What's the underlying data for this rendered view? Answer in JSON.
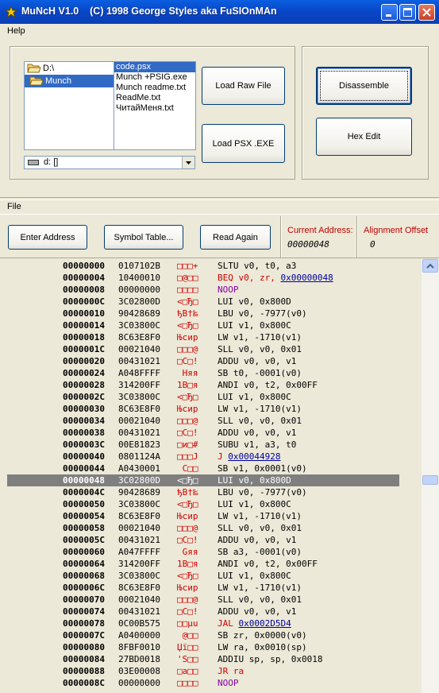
{
  "window": {
    "title": "MuNcH V1.0    (C) 1998 George Styles aka FuSIOnMAn"
  },
  "top_menu": {
    "help": "Help"
  },
  "dirs": [
    {
      "label": "D:\\",
      "selected": false
    },
    {
      "label": "Munch",
      "selected": true
    }
  ],
  "files": [
    {
      "label": "code.psx",
      "selected": true
    },
    {
      "label": "Munch +PSIG.exe",
      "selected": false
    },
    {
      "label": "Munch readme.txt",
      "selected": false
    },
    {
      "label": "ReadMe.txt",
      "selected": false
    },
    {
      "label": "ЧитайМеня.txt",
      "selected": false
    }
  ],
  "drive": {
    "value": "d: []"
  },
  "buttons": {
    "load_raw": "Load Raw File",
    "load_psx": "Load PSX .EXE",
    "disassemble": "Disassemble",
    "hex_edit": "Hex Edit",
    "enter_address": "Enter Address",
    "symbol_table": "Symbol Table...",
    "read_again": "Read Again"
  },
  "lower_menu": {
    "file": "File"
  },
  "info": {
    "current_address_label": "Current Address:",
    "current_address_value": "00000048",
    "alignment_label": "Alignment Offset",
    "alignment_value": "0"
  },
  "colors": {
    "titlebar": "#0847c8",
    "selection": "#316ac5",
    "branch": "#d00000",
    "nop": "#8800aa",
    "link": "#0000a0"
  },
  "rows": [
    {
      "addr": "00000000",
      "op": "0107102B",
      "chr": "□□□+",
      "mn": "SLTU v0, t0, a3",
      "kind": "normal"
    },
    {
      "addr": "00000004",
      "op": "10400010",
      "chr": "□@□□",
      "mn": "BEQ v0, zr, ",
      "link": "0x00000048",
      "kind": "branch"
    },
    {
      "addr": "00000008",
      "op": "00000000",
      "chr": "□□□□",
      "mn": "NOOP",
      "kind": "nop"
    },
    {
      "addr": "0000000C",
      "op": "3C02800D",
      "chr": "<□Ђ□",
      "mn": "LUI v0, 0x800D",
      "kind": "normal"
    },
    {
      "addr": "00000010",
      "op": "90428689",
      "chr": "ђB†‰",
      "mn": "LBU v0, -7977(v0)",
      "kind": "normal"
    },
    {
      "addr": "00000014",
      "op": "3C03800C",
      "chr": "<□Ђ□",
      "mn": "LUI v1, 0x800C",
      "kind": "normal"
    },
    {
      "addr": "00000018",
      "op": "8C63E8F0",
      "chr": "Њcир",
      "mn": "LW v1, -1710(v1)",
      "kind": "normal"
    },
    {
      "addr": "0000001C",
      "op": "00021040",
      "chr": "□□□@",
      "mn": "SLL v0, v0, 0x01",
      "kind": "normal"
    },
    {
      "addr": "00000020",
      "op": "00431021",
      "chr": "□C□!",
      "mn": "ADDU v0, v0, v1",
      "kind": "normal"
    },
    {
      "addr": "00000024",
      "op": "A048FFFF",
      "chr": " Hяя",
      "mn": "SB t0, -0001(v0)",
      "kind": "normal"
    },
    {
      "addr": "00000028",
      "op": "314200FF",
      "chr": "1B□я",
      "mn": "ANDI v0, t2, 0x00FF",
      "kind": "normal"
    },
    {
      "addr": "0000002C",
      "op": "3C03800C",
      "chr": "<□Ђ□",
      "mn": "LUI v1, 0x800C",
      "kind": "normal"
    },
    {
      "addr": "00000030",
      "op": "8C63E8F0",
      "chr": "Њcир",
      "mn": "LW v1, -1710(v1)",
      "kind": "normal"
    },
    {
      "addr": "00000034",
      "op": "00021040",
      "chr": "□□□@",
      "mn": "SLL v0, v0, 0x01",
      "kind": "normal"
    },
    {
      "addr": "00000038",
      "op": "00431021",
      "chr": "□C□!",
      "mn": "ADDU v0, v0, v1",
      "kind": "normal"
    },
    {
      "addr": "0000003C",
      "op": "00E81823",
      "chr": "□и□#",
      "mn": "SUBU v1, a3, t0",
      "kind": "normal"
    },
    {
      "addr": "00000040",
      "op": "0801124A",
      "chr": "□□□J",
      "mn": "J ",
      "link": "0x00044928",
      "kind": "branch"
    },
    {
      "addr": "00000044",
      "op": "A0430001",
      "chr": " C□□",
      "mn": "SB v1, 0x0001(v0)",
      "kind": "normal"
    },
    {
      "addr": "00000048",
      "op": "3C02800D",
      "chr": "<□Ђ□",
      "mn": "LUI v0, 0x800D",
      "kind": "selected"
    },
    {
      "addr": "0000004C",
      "op": "90428689",
      "chr": "ђB†‰",
      "mn": "LBU v0, -7977(v0)",
      "kind": "normal"
    },
    {
      "addr": "00000050",
      "op": "3C03800C",
      "chr": "<□Ђ□",
      "mn": "LUI v1, 0x800C",
      "kind": "normal"
    },
    {
      "addr": "00000054",
      "op": "8C63E8F0",
      "chr": "Њcир",
      "mn": "LW v1, -1710(v1)",
      "kind": "normal"
    },
    {
      "addr": "00000058",
      "op": "00021040",
      "chr": "□□□@",
      "mn": "SLL v0, v0, 0x01",
      "kind": "normal"
    },
    {
      "addr": "0000005C",
      "op": "00431021",
      "chr": "□C□!",
      "mn": "ADDU v0, v0, v1",
      "kind": "normal"
    },
    {
      "addr": "00000060",
      "op": "A047FFFF",
      "chr": " Gяя",
      "mn": "SB a3, -0001(v0)",
      "kind": "normal"
    },
    {
      "addr": "00000064",
      "op": "314200FF",
      "chr": "1B□я",
      "mn": "ANDI v0, t2, 0x00FF",
      "kind": "normal"
    },
    {
      "addr": "00000068",
      "op": "3C03800C",
      "chr": "<□Ђ□",
      "mn": "LUI v1, 0x800C",
      "kind": "normal"
    },
    {
      "addr": "0000006C",
      "op": "8C63E8F0",
      "chr": "Њcир",
      "mn": "LW v1, -1710(v1)",
      "kind": "normal"
    },
    {
      "addr": "00000070",
      "op": "00021040",
      "chr": "□□□@",
      "mn": "SLL v0, v0, 0x01",
      "kind": "normal"
    },
    {
      "addr": "00000074",
      "op": "00431021",
      "chr": "□C□!",
      "mn": "ADDU v0, v0, v1",
      "kind": "normal"
    },
    {
      "addr": "00000078",
      "op": "0C00B575",
      "chr": "□□µu",
      "mn": "JAL ",
      "link": "0x0002D5D4",
      "kind": "branch"
    },
    {
      "addr": "0000007C",
      "op": "A0400000",
      "chr": " @□□",
      "mn": "SB zr, 0x0000(v0)",
      "kind": "normal"
    },
    {
      "addr": "00000080",
      "op": "8FBF0010",
      "chr": "Џї□□",
      "mn": "LW ra, 0x0010(sp)",
      "kind": "normal"
    },
    {
      "addr": "00000084",
      "op": "27BD0018",
      "chr": "'Ѕ□□",
      "mn": "ADDIU sp, sp, 0x0018",
      "kind": "normal"
    },
    {
      "addr": "00000088",
      "op": "03E00008",
      "chr": "□а□□",
      "mn": "JR ra",
      "kind": "branch"
    },
    {
      "addr": "0000008C",
      "op": "00000000",
      "chr": "□□□□",
      "mn": "NOOP",
      "kind": "nop"
    }
  ]
}
